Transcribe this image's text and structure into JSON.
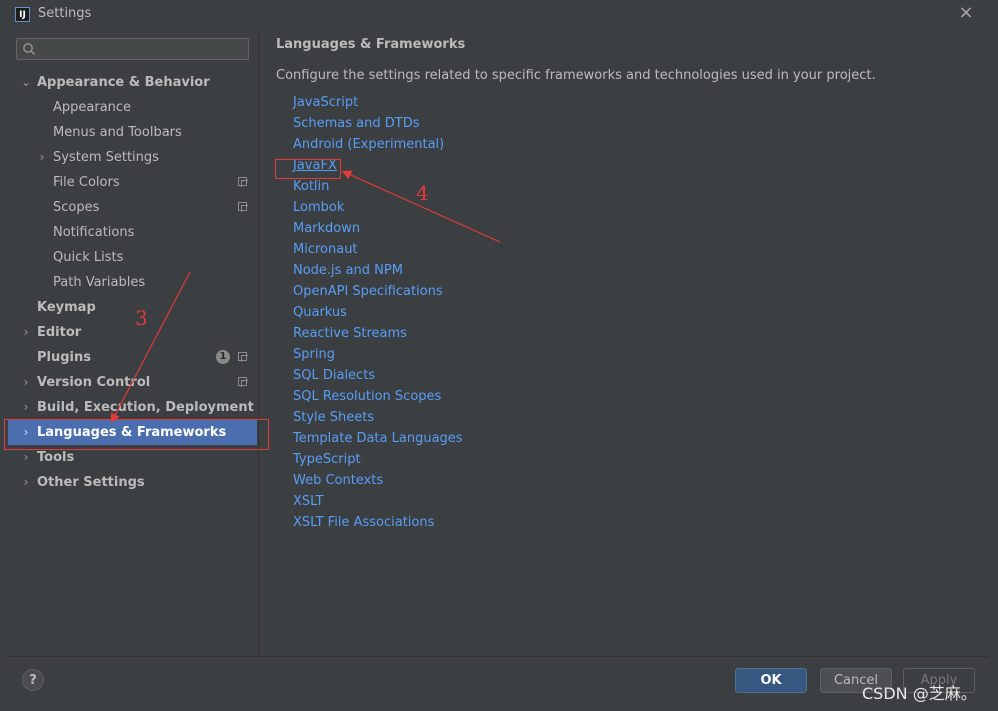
{
  "window": {
    "title": "Settings",
    "app_icon": "intellij-idea-icon",
    "close": "×"
  },
  "sidebar": {
    "search_placeholder": "",
    "items": [
      {
        "label": "Appearance & Behavior",
        "expanded": true
      },
      {
        "label": "Appearance"
      },
      {
        "label": "Menus and Toolbars"
      },
      {
        "label": "System Settings"
      },
      {
        "label": "File Colors"
      },
      {
        "label": "Scopes"
      },
      {
        "label": "Notifications"
      },
      {
        "label": "Quick Lists"
      },
      {
        "label": "Path Variables"
      },
      {
        "label": "Keymap"
      },
      {
        "label": "Editor"
      },
      {
        "label": "Plugins",
        "badge": "1"
      },
      {
        "label": "Version Control"
      },
      {
        "label": "Build, Execution, Deployment"
      },
      {
        "label": "Languages & Frameworks",
        "selected": true
      },
      {
        "label": "Tools"
      },
      {
        "label": "Other Settings"
      }
    ]
  },
  "content": {
    "title": "Languages & Frameworks",
    "description": "Configure the settings related to specific frameworks and technologies used in your project.",
    "links": [
      "JavaScript",
      "Schemas and DTDs",
      "Android (Experimental)",
      "JavaFX",
      "Kotlin",
      "Lombok",
      "Markdown",
      "Micronaut",
      "Node.js and NPM",
      "OpenAPI Specifications",
      "Quarkus",
      "Reactive Streams",
      "Spring",
      "SQL Dialects",
      "SQL Resolution Scopes",
      "Style Sheets",
      "Template Data Languages",
      "TypeScript",
      "Web Contexts",
      "XSLT",
      "XSLT File Associations"
    ]
  },
  "footer": {
    "help": "?",
    "ok": "OK",
    "cancel": "Cancel",
    "apply": "Apply"
  },
  "annotations": {
    "step3": "3",
    "step4": "4",
    "color": "#e23a3a"
  },
  "watermark": "CSDN @芝麻。",
  "colors": {
    "background": "#3c3f41",
    "selection": "#4b6eaf",
    "link": "#589df6",
    "ok_button": "#365880"
  }
}
